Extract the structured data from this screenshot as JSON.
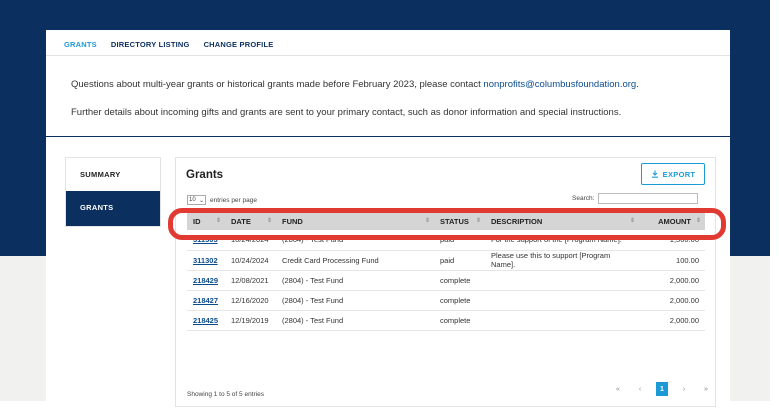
{
  "nav": {
    "tabs": [
      {
        "label": "GRANTS",
        "active": true
      },
      {
        "label": "DIRECTORY LISTING",
        "active": false
      },
      {
        "label": "CHANGE PROFILE",
        "active": false
      }
    ]
  },
  "info": {
    "line1_prefix": "Questions about multi-year grants or historical grants made before February 2023, please contact",
    "line1_link": "nonprofits@columbusfoundation.org",
    "line1_suffix": ".",
    "line2": "Further details about incoming gifts and grants are sent to your primary contact, such as donor information and special instructions."
  },
  "sidebar": {
    "items": [
      {
        "label": "SUMMARY",
        "active": false
      },
      {
        "label": "GRANTS",
        "active": true
      }
    ]
  },
  "panel": {
    "title": "Grants",
    "export_label": "EXPORT",
    "export_icon": "download-icon",
    "entries_value": "10",
    "entries_label": "entries per page",
    "search_label": "Search:",
    "search_value": ""
  },
  "table": {
    "headers": [
      "ID",
      "DATE",
      "FUND",
      "STATUS",
      "DESCRIPTION",
      "AMOUNT"
    ],
    "rows": [
      {
        "id": "311303",
        "date": "10/24/2024",
        "fund": "(2804) - Test Fund",
        "status": "paid",
        "description": "For the support of the [Program Name].",
        "amount": "1,500.00"
      },
      {
        "id": "311302",
        "date": "10/24/2024",
        "fund": "Credit Card Processing Fund",
        "status": "paid",
        "description": "Please use this to support [Program Name].",
        "amount": "100.00"
      },
      {
        "id": "218429",
        "date": "12/08/2021",
        "fund": "(2804) - Test Fund",
        "status": "complete",
        "description": "",
        "amount": "2,000.00"
      },
      {
        "id": "218427",
        "date": "12/16/2020",
        "fund": "(2804) - Test Fund",
        "status": "complete",
        "description": "",
        "amount": "2,000.00"
      },
      {
        "id": "218425",
        "date": "12/19/2019",
        "fund": "(2804) - Test Fund",
        "status": "complete",
        "description": "",
        "amount": "2,000.00"
      }
    ]
  },
  "footer": {
    "showing": "Showing 1 to 5 of 5 entries",
    "pager": {
      "first": "«",
      "prev": "‹",
      "current": "1",
      "next": "›",
      "last": "»"
    }
  },
  "colors": {
    "navy": "#0b2f5e",
    "accent": "#1c9ad6",
    "highlight": "#e03a32"
  }
}
